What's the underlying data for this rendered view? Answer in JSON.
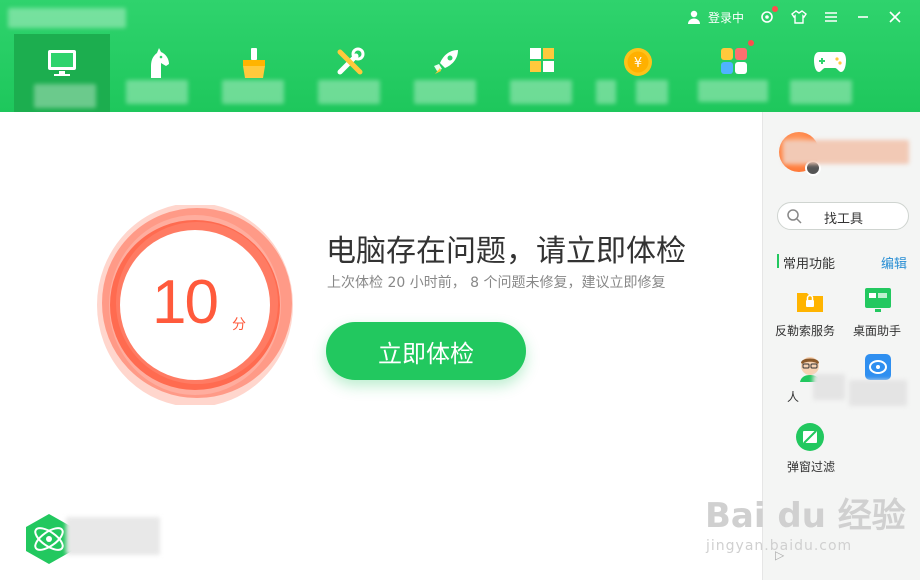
{
  "app": {
    "title": ""
  },
  "topbar": {
    "login_label": "登录中",
    "nav": [
      {
        "label": "",
        "icon": "monitor-icon",
        "active": true
      },
      {
        "label": "",
        "icon": "horse-icon"
      },
      {
        "label": "",
        "icon": "broom-icon"
      },
      {
        "label": "",
        "icon": "tools-icon"
      },
      {
        "label": "",
        "icon": "rocket-icon"
      },
      {
        "label": "",
        "icon": "apps-grid-icon"
      },
      {
        "label": "",
        "icon": "coin-icon"
      },
      {
        "label": "",
        "icon": "colorful-grid-icon"
      },
      {
        "label": "",
        "icon": "gamepad-icon"
      }
    ]
  },
  "main": {
    "score": "10",
    "score_unit": "分",
    "headline": "电脑存在问题，请立即体检",
    "subline": "上次体检 20 小时前， 8 个问题未修复，建议立即修复",
    "check_button": "立即体检"
  },
  "side": {
    "search_label": "找工具",
    "section_title": "常用功能",
    "section_edit": "编辑",
    "tools": [
      {
        "label": "反勒索服务",
        "icon": "folder-lock-icon"
      },
      {
        "label": "桌面助手",
        "icon": "desktop-assistant-icon"
      },
      {
        "label": "人",
        "icon": "person-avatar-icon"
      },
      {
        "label": "",
        "icon": "shield-box-icon"
      },
      {
        "label": "弹窗过滤",
        "icon": "popup-filter-icon"
      }
    ]
  },
  "watermark": {
    "text": "Bai du 经验",
    "sub": "jingyan.baidu.com"
  }
}
